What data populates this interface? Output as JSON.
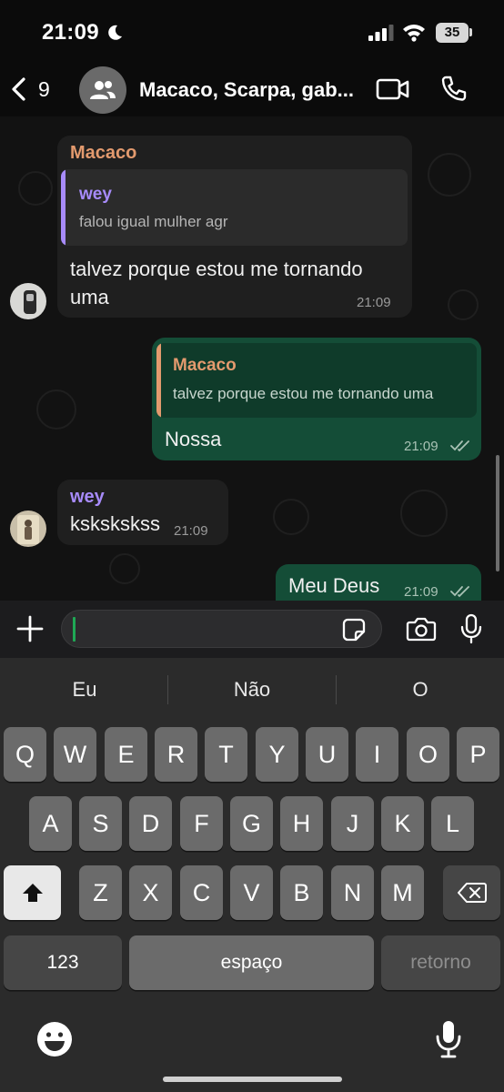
{
  "status_bar": {
    "time": "21:09",
    "battery": "35"
  },
  "header": {
    "unread_count": "9",
    "title": "Macaco, Scarpa, gab..."
  },
  "messages": [
    {
      "sender": "Macaco",
      "sender_color": "#e39a6e",
      "quote": {
        "author": "wey",
        "author_color": "#a78bfa",
        "text": "falou igual mulher agr"
      },
      "text_line1": "talvez porque estou me tornando",
      "text_line2": "uma",
      "time": "21:09"
    },
    {
      "outgoing": true,
      "quote": {
        "author": "Macaco",
        "author_color": "#e39a6e",
        "text": "talvez porque estou me tornando uma"
      },
      "text": "Nossa",
      "time": "21:09",
      "status": "read"
    },
    {
      "sender": "wey",
      "sender_color": "#a78bfa",
      "text": "kskskskss",
      "time": "21:09"
    },
    {
      "outgoing": true,
      "text": "Meu Deus",
      "time": "21:09",
      "status": "read"
    }
  ],
  "keyboard": {
    "suggestions": [
      "Eu",
      "Não",
      "O"
    ],
    "row1": [
      "Q",
      "W",
      "E",
      "R",
      "T",
      "Y",
      "U",
      "I",
      "O",
      "P"
    ],
    "row2": [
      "A",
      "S",
      "D",
      "F",
      "G",
      "H",
      "J",
      "K",
      "L"
    ],
    "row3": [
      "Z",
      "X",
      "C",
      "V",
      "B",
      "N",
      "M"
    ],
    "numbers_label": "123",
    "space_label": "espaço",
    "return_label": "retorno"
  },
  "colors": {
    "outgoing_bubble": "#144d37",
    "incoming_bubble": "#1f1f1f",
    "accent_green": "#1fa855"
  }
}
